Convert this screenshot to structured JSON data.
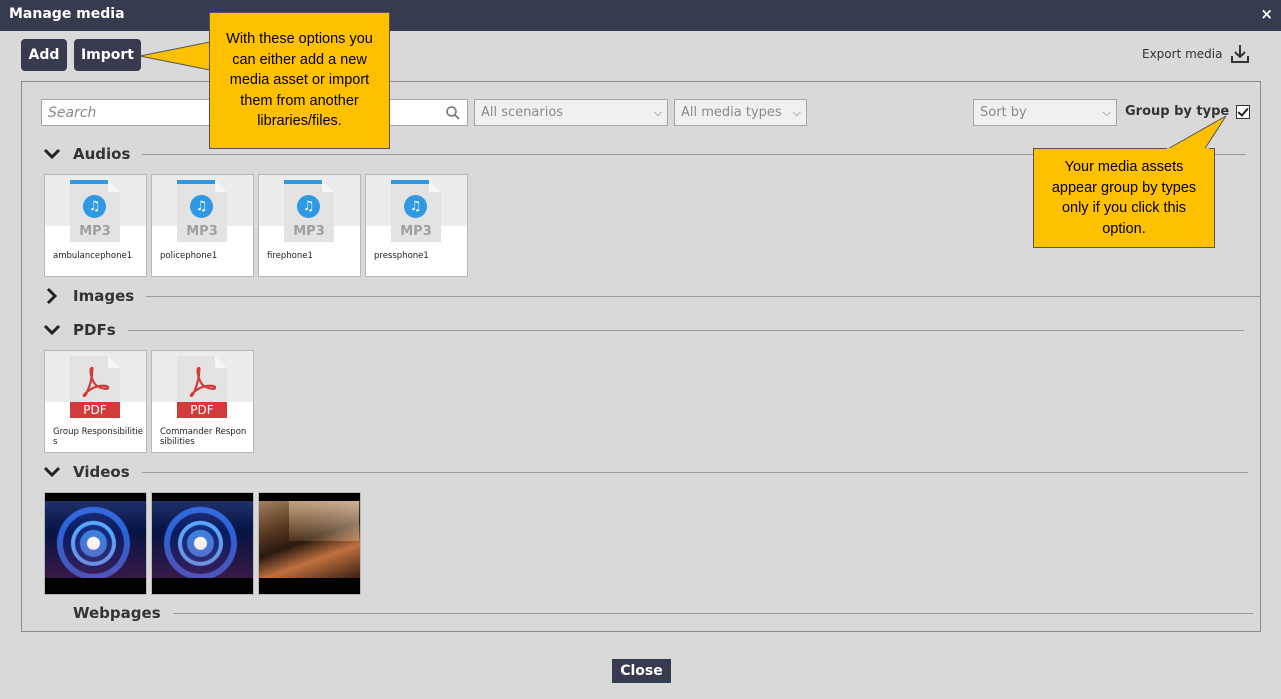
{
  "window": {
    "title": "Manage media",
    "close_glyph": "×"
  },
  "toolbar": {
    "add_label": "Add",
    "import_label": "Import",
    "export_label": "Export media"
  },
  "filters": {
    "search_placeholder": "Search",
    "scenarios_value": "All scenarios",
    "media_types_value": "All media types",
    "sort_value": "Sort by",
    "group_by_label": "Group by type",
    "group_by_checked": true
  },
  "sections": {
    "audios": {
      "title": "Audios",
      "expanded": true,
      "items": [
        {
          "name": "ambulancephone1",
          "ext": "MP3"
        },
        {
          "name": "policephone1",
          "ext": "MP3"
        },
        {
          "name": "firephone1",
          "ext": "MP3"
        },
        {
          "name": "pressphone1",
          "ext": "MP3"
        }
      ]
    },
    "images": {
      "title": "Images",
      "expanded": false
    },
    "pdfs": {
      "title": "PDFs",
      "expanded": true,
      "items": [
        {
          "name": "Group Responsibilities",
          "ext": "PDF"
        },
        {
          "name": "Commander Responsibilities",
          "ext": "PDF"
        }
      ]
    },
    "videos": {
      "title": "Videos",
      "expanded": true
    },
    "webpages": {
      "title": "Webpages"
    }
  },
  "callouts": {
    "import_tip": "With these options you can either add a new media asset or import them from another libraries/files.",
    "group_tip": "Your media assets appear group by types only if you click this option."
  },
  "footer": {
    "close_label": "Close"
  },
  "colors": {
    "titlebar": "#363b4f",
    "accent_blue": "#2f9ae3",
    "pdf_red": "#d13b3b",
    "callout": "#ffc000"
  },
  "icons": {
    "audio": "music-note-icon",
    "pdf": "acrobat-icon",
    "search": "search-icon",
    "export": "download-icon"
  }
}
